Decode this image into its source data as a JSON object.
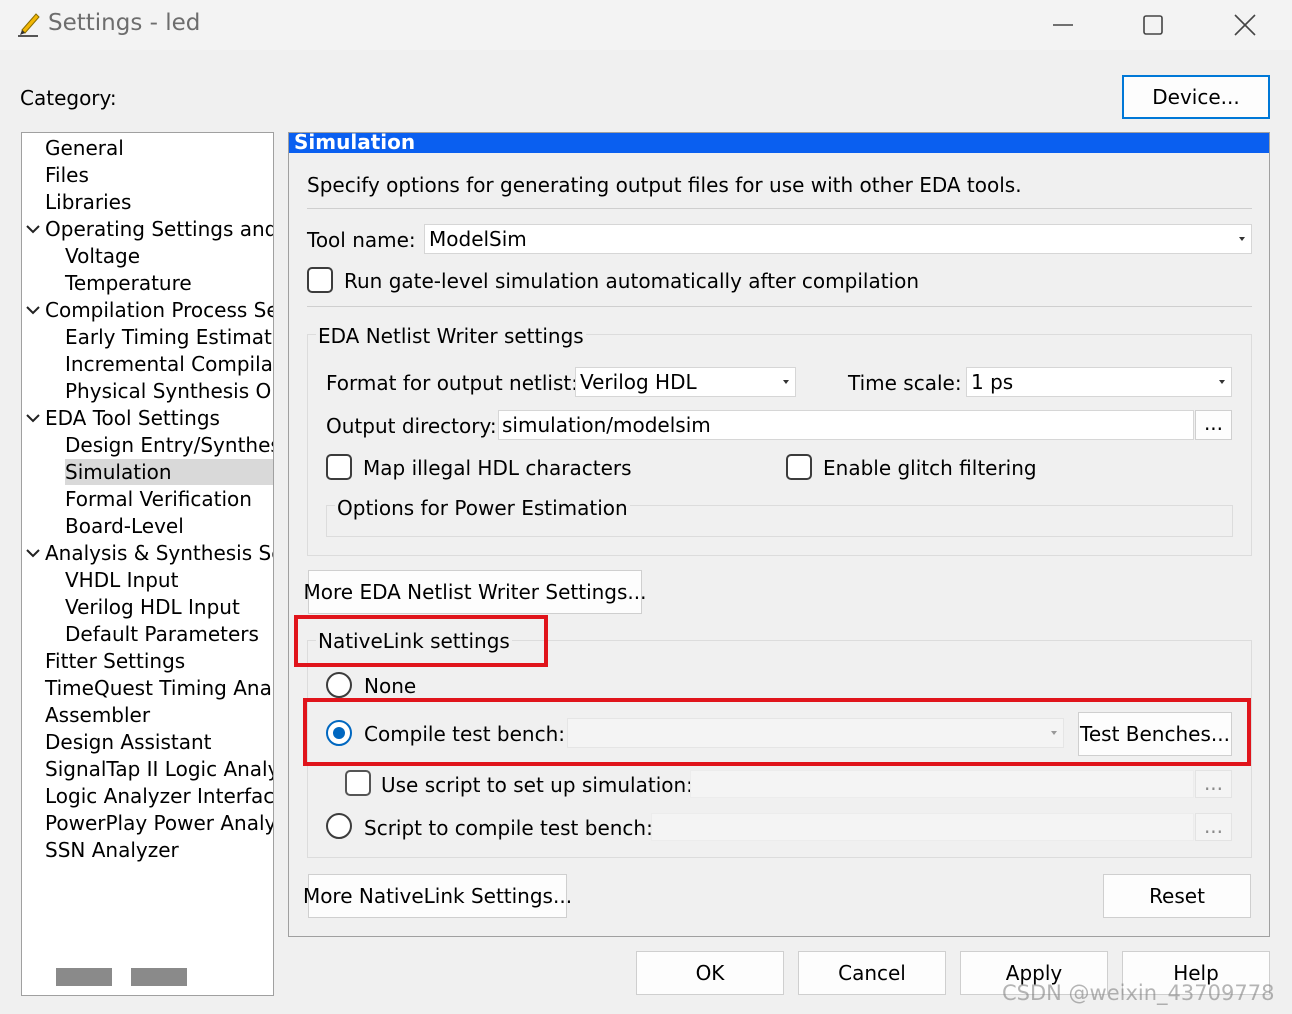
{
  "window": {
    "title": "Settings - led",
    "icon": "pencil-icon",
    "controls": [
      "minimize-icon",
      "maximize-icon",
      "close-icon"
    ]
  },
  "category_label": "Category:",
  "device_button": "Device...",
  "tree": {
    "items": [
      {
        "label": "General",
        "level": 0
      },
      {
        "label": "Files",
        "level": 0
      },
      {
        "label": "Libraries",
        "level": 0
      },
      {
        "label": "Operating Settings and C",
        "level": 0,
        "expanded": true
      },
      {
        "label": "Voltage",
        "level": 1
      },
      {
        "label": "Temperature",
        "level": 1
      },
      {
        "label": "Compilation Process Sett",
        "level": 0,
        "expanded": true
      },
      {
        "label": "Early Timing Estimate",
        "level": 1
      },
      {
        "label": "Incremental Compilati",
        "level": 1
      },
      {
        "label": "Physical Synthesis Opt",
        "level": 1
      },
      {
        "label": "EDA Tool Settings",
        "level": 0,
        "expanded": true
      },
      {
        "label": "Design Entry/Synthesis",
        "level": 1
      },
      {
        "label": "Simulation",
        "level": 1,
        "selected": true
      },
      {
        "label": "Formal Verification",
        "level": 1
      },
      {
        "label": "Board-Level",
        "level": 1
      },
      {
        "label": "Analysis & Synthesis Sett",
        "level": 0,
        "expanded": true
      },
      {
        "label": "VHDL Input",
        "level": 1
      },
      {
        "label": "Verilog HDL Input",
        "level": 1
      },
      {
        "label": "Default Parameters",
        "level": 1
      },
      {
        "label": "Fitter Settings",
        "level": 0
      },
      {
        "label": "TimeQuest Timing Analy",
        "level": 0
      },
      {
        "label": "Assembler",
        "level": 0
      },
      {
        "label": "Design Assistant",
        "level": 0
      },
      {
        "label": "SignalTap II Logic Analy",
        "level": 0
      },
      {
        "label": "Logic Analyzer Interface",
        "level": 0
      },
      {
        "label": "PowerPlay Power Analyz",
        "level": 0
      },
      {
        "label": "SSN Analyzer",
        "level": 0
      }
    ]
  },
  "panel": {
    "header": "Simulation",
    "header_color": "#0a5ff0",
    "description": "Specify options for generating output files for use with other EDA tools.",
    "tool_name_label": "Tool name:",
    "tool_name_value": "ModelSim",
    "run_gate_level_label": "Run gate-level simulation automatically after compilation",
    "run_gate_level_checked": false,
    "netlist_group_title": "EDA Netlist Writer settings",
    "format_label": "Format for output netlist:",
    "format_value": "Verilog HDL",
    "timescale_label": "Time scale:",
    "timescale_value": "1 ps",
    "output_dir_label": "Output directory:",
    "output_dir_value": "simulation/modelsim",
    "browse_label": "...",
    "map_illegal_label": "Map illegal HDL characters",
    "map_illegal_checked": false,
    "glitch_label": "Enable glitch filtering",
    "glitch_checked": false,
    "power_group_title": "Options for Power Estimation",
    "more_netlist_button": "More EDA Netlist Writer Settings...",
    "nativelink_group_title": "NativeLink settings",
    "radio_none_label": "None",
    "radio_compile_tb_label": "Compile test bench:",
    "compile_tb_value": "",
    "test_benches_button": "Test Benches...",
    "use_script_label": "Use script to set up simulation:",
    "use_script_value": "",
    "radio_script_label": "Script to compile test bench:",
    "script_value": "",
    "selected_radio": "compile_test_bench",
    "more_nativelink_button": "More NativeLink Settings...",
    "reset_button": "Reset"
  },
  "footer": {
    "ok": "OK",
    "cancel": "Cancel",
    "apply": "Apply",
    "help": "Help"
  },
  "watermark": "CSDN @weixin_43709778",
  "highlight_color": "#e0141b"
}
